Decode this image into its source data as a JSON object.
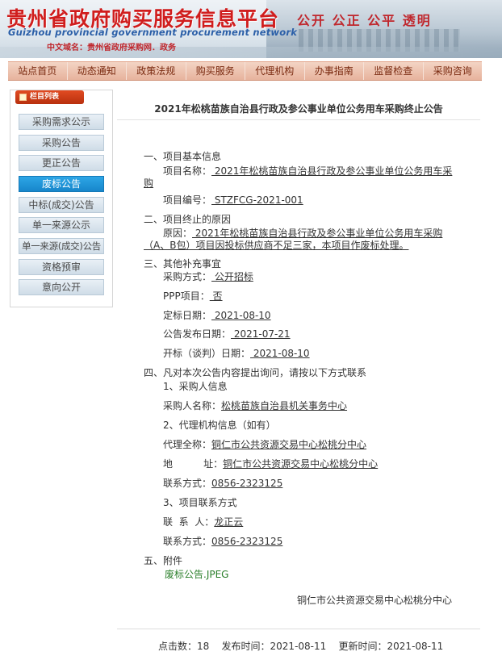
{
  "header": {
    "site_title": "贵州省政府购买服务信息平台",
    "site_title_en": "Guizhou provincial government procurement network",
    "domain_text": "中文域名：贵州省政府采购网．政务",
    "slogan": "公开  公正  公平  透明"
  },
  "nav": [
    "站点首页",
    "动态通知",
    "政策法规",
    "购买服务",
    "代理机构",
    "办事指南",
    "监督检查",
    "采购咨询"
  ],
  "sidebar": {
    "heading": "栏目列表",
    "items": [
      {
        "label": "采购需求公示"
      },
      {
        "label": "采购公告"
      },
      {
        "label": "更正公告"
      },
      {
        "label": "废标公告",
        "active": true
      },
      {
        "label": "中标(成交)公告"
      },
      {
        "label": "单一来源公示"
      },
      {
        "label": "单一来源(成交)公告"
      },
      {
        "label": "资格预审"
      },
      {
        "label": "意向公开"
      }
    ]
  },
  "article": {
    "title": "2021年松桃苗族自治县行政及参公事业单位公务用车采购终止公告",
    "s1_heading": "一、项目基本信息",
    "project_name_label": "项目名称：",
    "project_name_1": " 2021年松桃苗族自治县行政及参公事业单位公务用车采",
    "project_name_2": "购",
    "project_no_label": "项目编号：",
    "project_no": " STZFCG-2021-001",
    "s2_heading": "二、项目终止的原因",
    "reason_label": "原因：",
    "reason_1": " 2021年松桃苗族自治县行政及参公事业单位公务用车采购",
    "reason_2": "（A、B包）项目因投标供应商不足三家，本项目作废标处理。",
    "s3_heading": "三、其他补充事宜",
    "method_label": "采购方式：",
    "method": " 公开招标",
    "ppp_label": "PPP项目：",
    "ppp": " 否",
    "decide_label": "定标日期：",
    "decide_date": " 2021-08-10",
    "publish_label": "公告发布日期：",
    "publish_date": " 2021-07-21",
    "open_label": "开标（谈判）日期：",
    "open_date": " 2021-08-10",
    "s4_heading": "四、凡对本次公告内容提出询问，请按以下方式联系",
    "buyer_heading": "1、采购人信息",
    "buyer_name_label": "采购人名称：",
    "buyer_name": "松桃苗族自治县机关事务中心",
    "agent_heading": "2、代理机构信息（如有）",
    "agent_name_label": "代理全称：",
    "agent_name": "铜仁市公共资源交易中心松桃分中心",
    "agent_addr_label": "地          址：",
    "agent_addr": "铜仁市公共资源交易中心松桃分中心",
    "agent_phone_label": "联系方式：",
    "agent_phone": "0856-2323125",
    "contact_heading": "3、项目联系方式",
    "contact_person_label": "联  系  人：",
    "contact_person": "龙正云",
    "contact_phone_label": "联系方式：",
    "contact_phone": "0856-2323125",
    "s5_heading": "五、附件",
    "attachment": "废标公告.JPEG",
    "signature": "铜仁市公共资源交易中心松桃分中心"
  },
  "footer": {
    "text": "点击数：18    发布时间：2021-08-11    更新时间：2021-08-11"
  },
  "colors": {
    "title_red": "#d01d1d",
    "nav_bg": "#e7b39d",
    "active_blue": "#1786cb",
    "link_green": "#2a7f2a"
  }
}
